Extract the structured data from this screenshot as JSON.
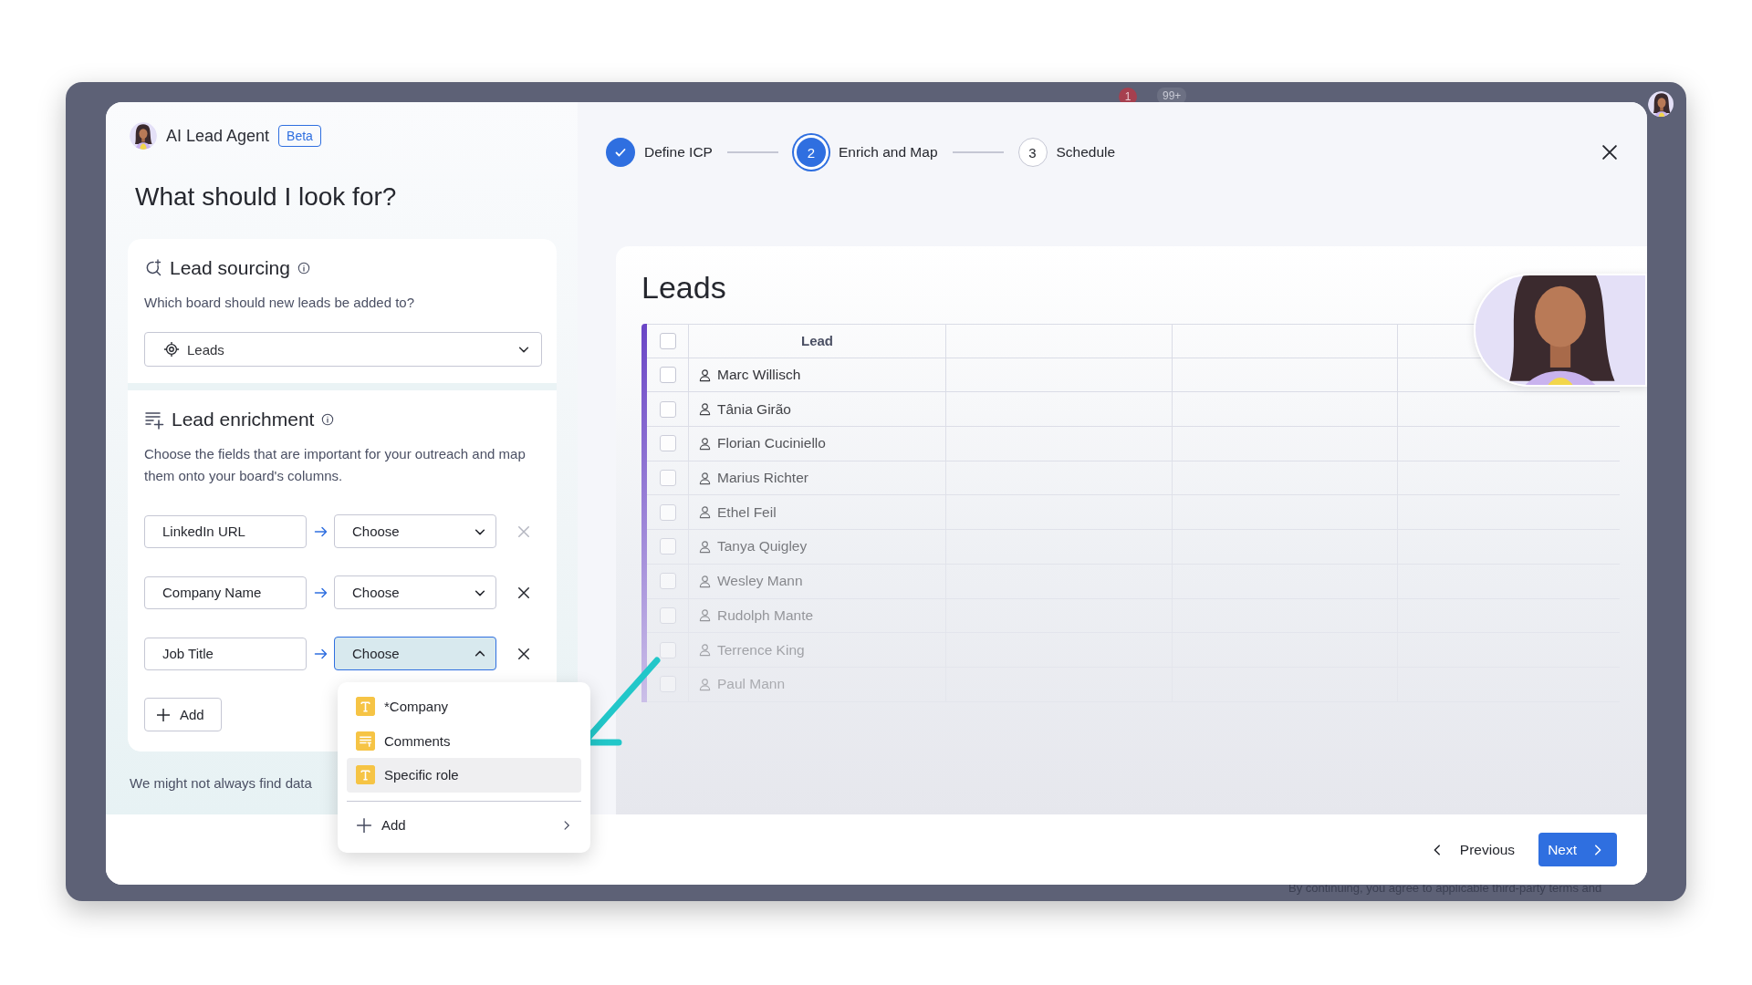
{
  "backdrop": {
    "notification_count": "1",
    "updates_badge": "99+",
    "footer_text": "By continuing, you agree to applicable third-party terms and"
  },
  "agent": {
    "name": "AI Lead Agent",
    "badge": "Beta"
  },
  "heading": "What should I look for?",
  "lead_sourcing": {
    "title": "Lead sourcing",
    "question": "Which board should new leads be added to?",
    "board_select": {
      "value": "Leads"
    }
  },
  "lead_enrichment": {
    "title": "Lead enrichment",
    "description": "Choose the fields that are important for your outreach and map them onto your board's columns.",
    "mappings": [
      {
        "field": "LinkedIn URL",
        "target": {
          "placeholder": "Choose"
        },
        "expanded": false,
        "removable": false
      },
      {
        "field": "Company Name",
        "target": {
          "placeholder": "Choose"
        },
        "expanded": false,
        "removable": true
      },
      {
        "field": "Job Title",
        "target": {
          "placeholder": "Choose"
        },
        "expanded": true,
        "removable": true
      }
    ],
    "add_button": "Add"
  },
  "note": "We might not always find data",
  "column_menu": {
    "items": [
      {
        "label": "*Company",
        "kind": "text",
        "selected": false
      },
      {
        "label": "Comments",
        "kind": "long_text",
        "selected": false
      },
      {
        "label": "Specific role",
        "kind": "text",
        "selected": true
      }
    ],
    "add_item": "Add"
  },
  "steps": [
    {
      "label": "Define ICP",
      "completed": true,
      "selected": false
    },
    {
      "number": "2",
      "label": "Enrich and Map",
      "completed": false,
      "selected": true
    },
    {
      "number": "3",
      "label": "Schedule",
      "completed": false,
      "selected": false
    }
  ],
  "board": {
    "title": "Leads",
    "all_checked": false,
    "columns": [
      "Lead"
    ],
    "rows": [
      {
        "name": "Marc Willisch",
        "checked": false
      },
      {
        "name": "Tânia Girão",
        "checked": false
      },
      {
        "name": "Florian Cuciniello",
        "checked": false
      },
      {
        "name": "Marius Richter",
        "checked": false
      },
      {
        "name": "Ethel Feil",
        "checked": false
      },
      {
        "name": "Tanya Quigley",
        "checked": false
      },
      {
        "name": "Wesley Mann",
        "checked": false
      },
      {
        "name": "Rudolph Mante",
        "checked": false
      },
      {
        "name": "Terrence King",
        "checked": false
      },
      {
        "name": "Paul Mann",
        "checked": false
      }
    ]
  },
  "footer": {
    "previous": "Previous",
    "next": "Next"
  }
}
